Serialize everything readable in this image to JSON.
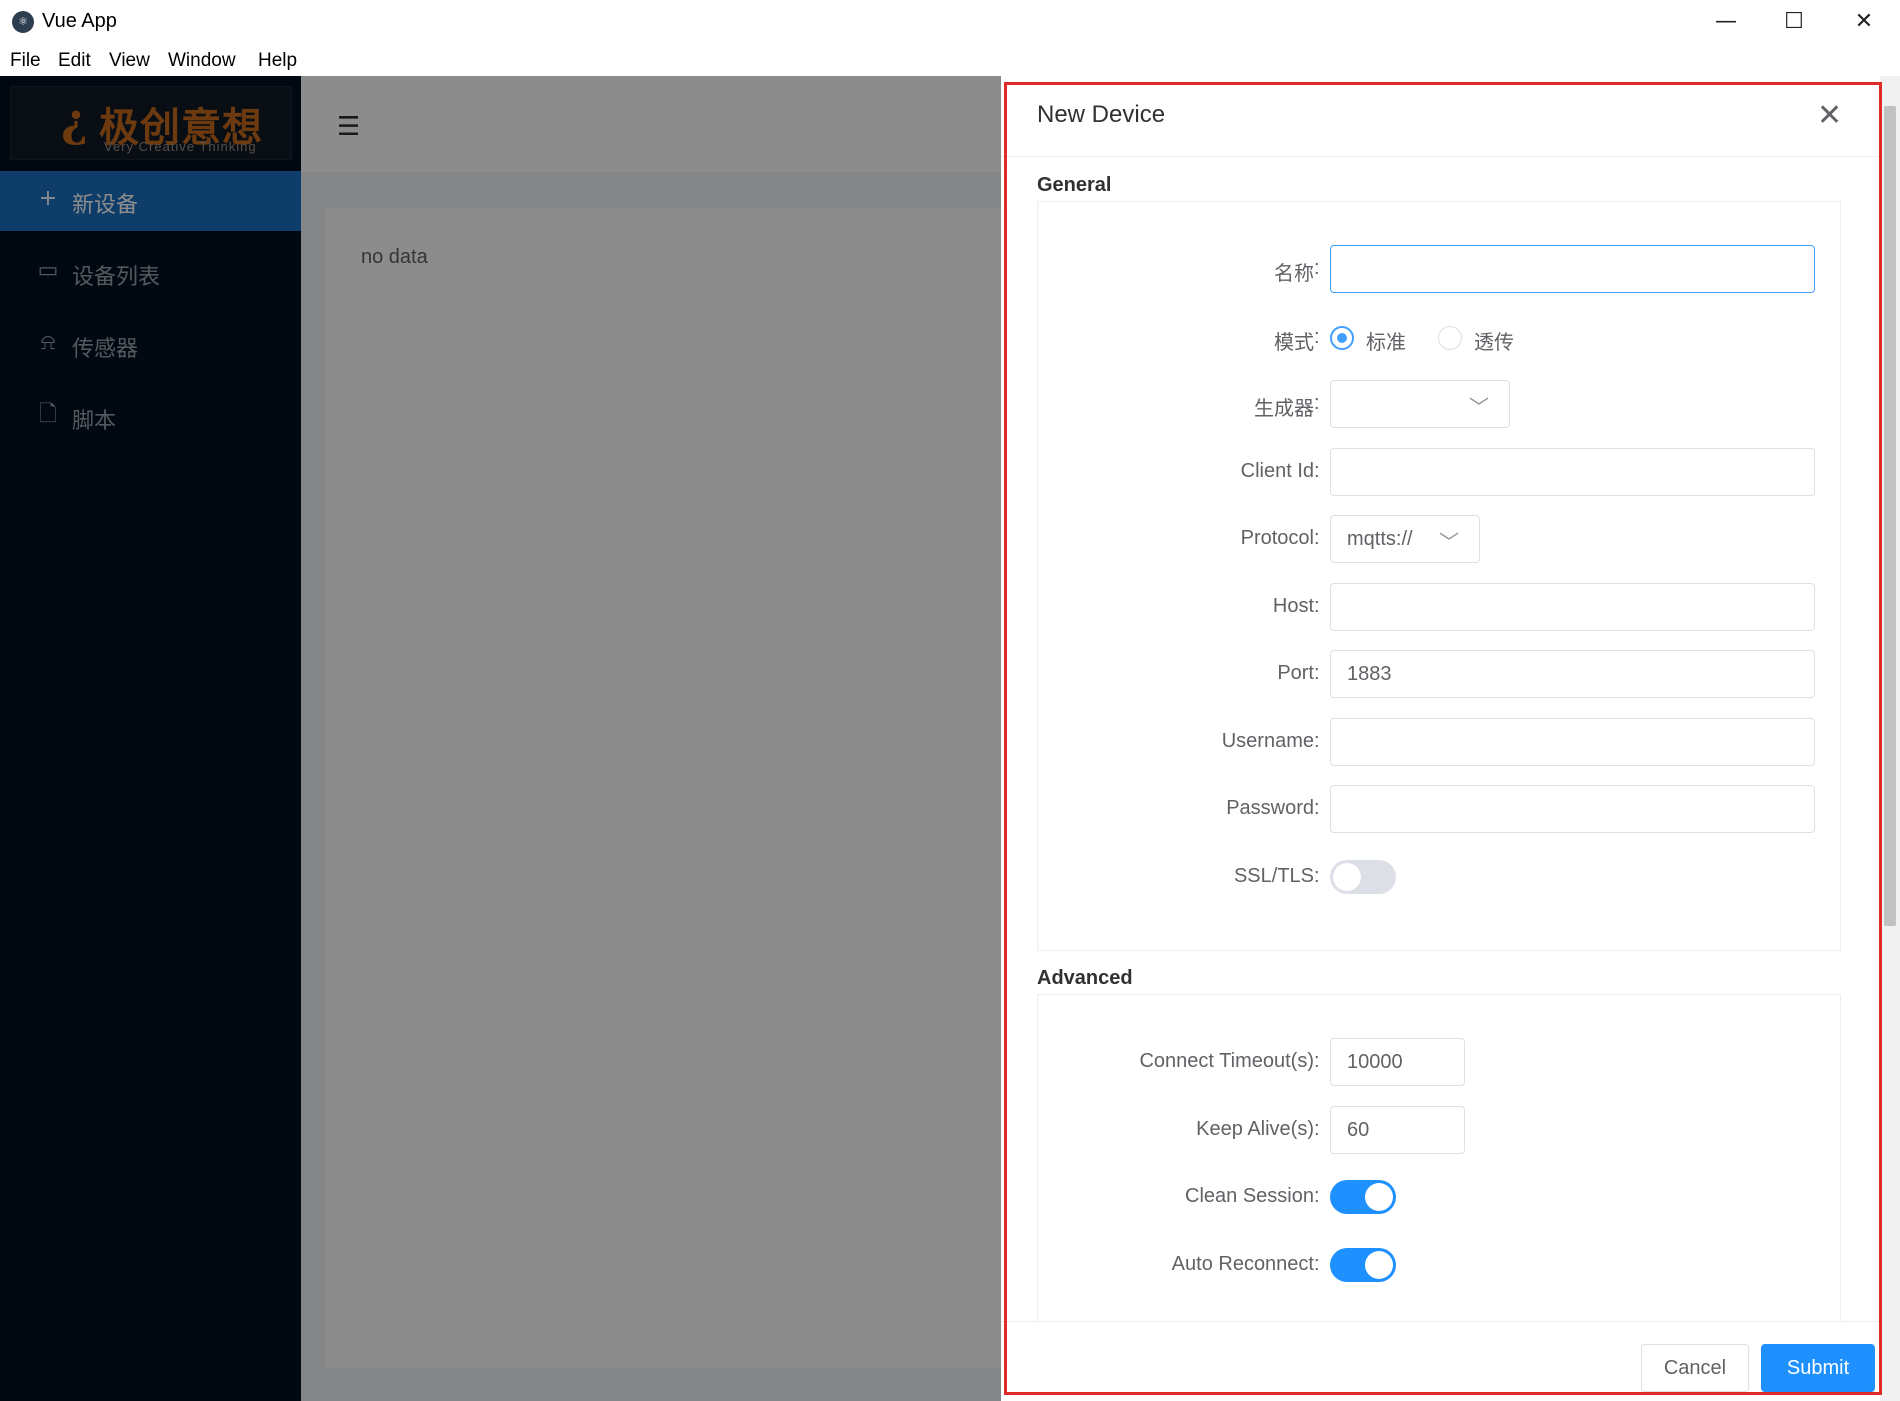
{
  "window": {
    "title": "Vue App",
    "app_icon": "vue-app-icon",
    "controls": {
      "minimize": "—",
      "maximize": "☐",
      "close": "✕"
    }
  },
  "menubar": {
    "items": [
      "File",
      "Edit",
      "View",
      "Window",
      "Help"
    ]
  },
  "sidebar": {
    "logo": {
      "mark": "¿",
      "text_cn": "极创意想",
      "text_en": "Very Creative Thinking"
    },
    "items": [
      {
        "icon": "plus-icon",
        "glyph": "+",
        "label": "新设备",
        "active": true
      },
      {
        "icon": "monitor-icon",
        "glyph": "▭",
        "label": "设备列表",
        "active": false
      },
      {
        "icon": "alarm-icon",
        "glyph": "⍾",
        "label": "传感器",
        "active": false
      },
      {
        "icon": "document-icon",
        "glyph": "🗋",
        "label": "脚本",
        "active": false
      }
    ]
  },
  "main": {
    "fold_icon": "☰",
    "empty_text": "no data"
  },
  "drawer": {
    "title": "New Device",
    "close_glyph": "✕",
    "general": {
      "title": "General",
      "name_label": "名称",
      "name_value": "",
      "mode_label": "模式",
      "mode_options": [
        "标准",
        "透传"
      ],
      "mode_selected": "标准",
      "generator_label": "生成器",
      "generator_value": "",
      "client_id_label": "Client Id",
      "client_id_value": "",
      "protocol_label": "Protocol",
      "protocol_value": "mqtts://",
      "host_label": "Host",
      "host_value": "",
      "port_label": "Port",
      "port_value": "1883",
      "username_label": "Username",
      "username_value": "",
      "password_label": "Password",
      "password_value": "",
      "ssl_label": "SSL/TLS",
      "ssl_on": false
    },
    "advanced": {
      "title": "Advanced",
      "timeout_label": "Connect Timeout(s)",
      "timeout_value": "10000",
      "keepalive_label": "Keep Alive(s)",
      "keepalive_value": "60",
      "clean_session_label": "Clean Session",
      "clean_session_on": true,
      "auto_reconnect_label": "Auto Reconnect",
      "auto_reconnect_on": true
    },
    "footer": {
      "cancel_label": "Cancel",
      "submit_label": "Submit"
    },
    "colors": {
      "primary": "#1e90ff",
      "highlight": "#e02a2a"
    }
  }
}
